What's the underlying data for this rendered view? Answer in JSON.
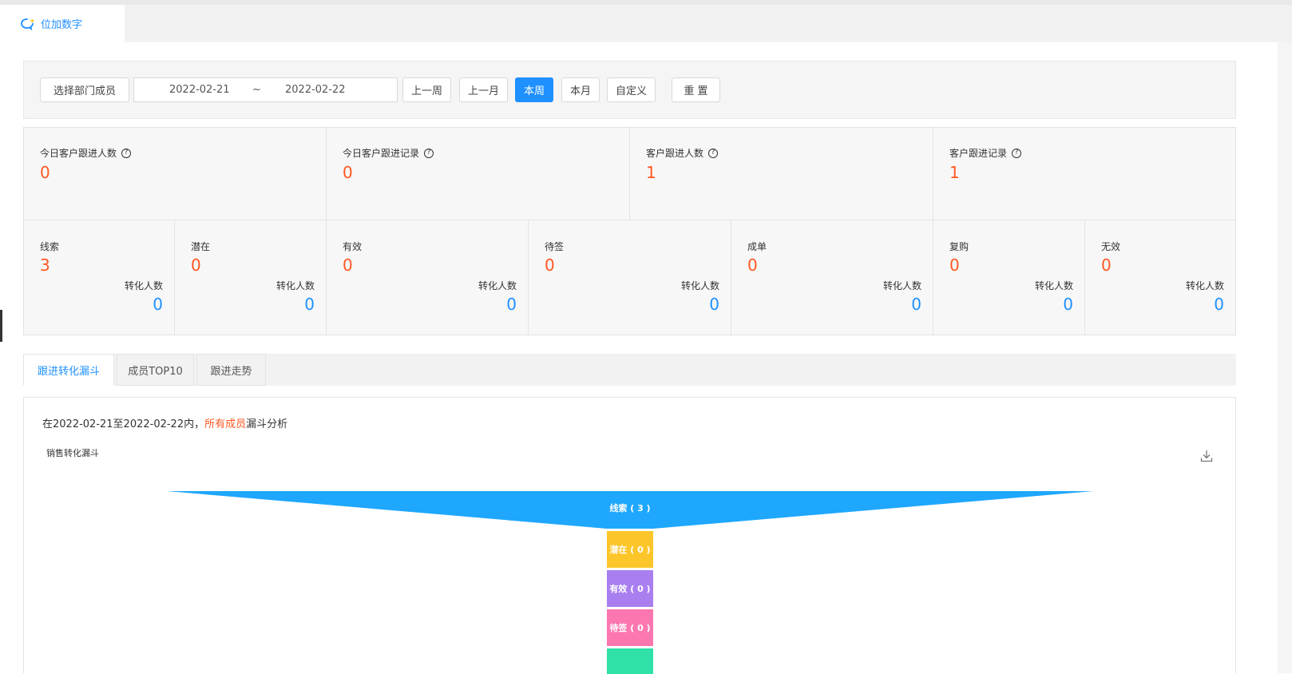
{
  "app_tab": {
    "title": "位加数字"
  },
  "filter": {
    "select_members": "选择部门成员",
    "date_start": "2022-02-21",
    "date_sep": "~",
    "date_end": "2022-02-22",
    "prev_week": "上一周",
    "prev_month": "上一月",
    "this_week": "本周",
    "this_month": "本月",
    "custom": "自定义",
    "reset": "重 置"
  },
  "summary_stats": [
    {
      "label": "今日客户跟进人数",
      "value": "0"
    },
    {
      "label": "今日客户跟进记录",
      "value": "0"
    },
    {
      "label": "客户跟进人数",
      "value": "1"
    },
    {
      "label": "客户跟进记录",
      "value": "1"
    }
  ],
  "stage_stats": [
    {
      "label": "线索",
      "value": "3",
      "conv_label": "转化人数",
      "conv_value": "0"
    },
    {
      "label": "潜在",
      "value": "0",
      "conv_label": "转化人数",
      "conv_value": "0"
    },
    {
      "label": "有效",
      "value": "0",
      "conv_label": "转化人数",
      "conv_value": "0"
    },
    {
      "label": "待签",
      "value": "0",
      "conv_label": "转化人数",
      "conv_value": "0"
    },
    {
      "label": "成单",
      "value": "0",
      "conv_label": "转化人数",
      "conv_value": "0"
    },
    {
      "label": "复购",
      "value": "0",
      "conv_label": "转化人数",
      "conv_value": "0"
    },
    {
      "label": "无效",
      "value": "0",
      "conv_label": "转化人数",
      "conv_value": "0"
    }
  ],
  "tabs": [
    "跟进转化漏斗",
    "成员TOP10",
    "跟进走势"
  ],
  "summary_line": {
    "prefix": "在2022-02-21至2022-02-22内，",
    "highlight": "所有成员",
    "suffix": "漏斗分析"
  },
  "funnel": {
    "title": "销售转化漏斗",
    "stages": [
      {
        "label": "线索 ( 3 )",
        "value": 3,
        "color": "#1ea7fd"
      },
      {
        "label": "潜在 ( 0 )",
        "value": 0,
        "color": "#fcc62a"
      },
      {
        "label": "有效 ( 0 )",
        "value": 0,
        "color": "#a97ff0"
      },
      {
        "label": "待签 ( 0 )",
        "value": 0,
        "color": "#fc77b0"
      },
      {
        "label": "",
        "value": 0,
        "color": "#2fe0a8"
      }
    ]
  }
}
